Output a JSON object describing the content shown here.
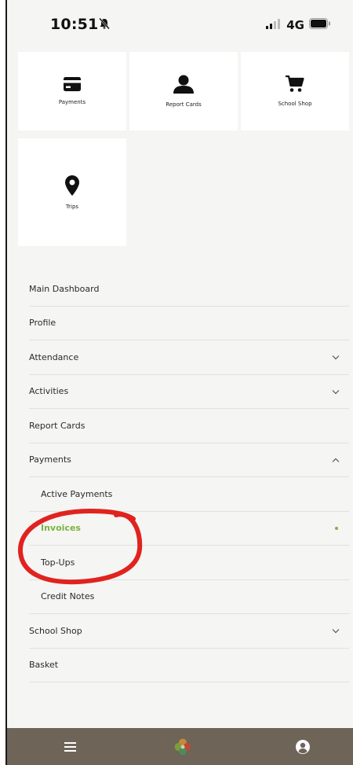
{
  "status_bar": {
    "time": "10:51",
    "network": "4G",
    "icons": [
      "silent-bell-icon",
      "signal-icon",
      "battery-icon"
    ]
  },
  "tiles": [
    {
      "label": "Payments",
      "icon": "credit-card-icon"
    },
    {
      "label": "Report Cards",
      "icon": "person-icon"
    },
    {
      "label": "School Shop",
      "icon": "shopping-cart-icon"
    },
    {
      "label": "Trips",
      "icon": "map-pin-icon"
    }
  ],
  "menu": {
    "items": [
      {
        "label": "Main Dashboard"
      },
      {
        "label": "Profile"
      },
      {
        "label": "Attendance",
        "chevron": "down"
      },
      {
        "label": "Activities",
        "chevron": "down"
      },
      {
        "label": "Report Cards"
      },
      {
        "label": "Payments",
        "chevron": "up",
        "expanded": true
      },
      {
        "label": "Active Payments",
        "sub": true
      },
      {
        "label": "Invoices",
        "sub": true,
        "active": true
      },
      {
        "label": "Top-Ups",
        "sub": true
      },
      {
        "label": "Credit Notes",
        "sub": true
      },
      {
        "label": "School Shop",
        "chevron": "down"
      },
      {
        "label": "Basket"
      }
    ]
  },
  "bottom_nav": {
    "items": [
      "hamburger-menu-icon",
      "app-logo-icon",
      "account-icon"
    ]
  },
  "colors": {
    "active": "#7cb342",
    "bottom_bar": "#6e6458",
    "annotation": "#e0231f"
  }
}
